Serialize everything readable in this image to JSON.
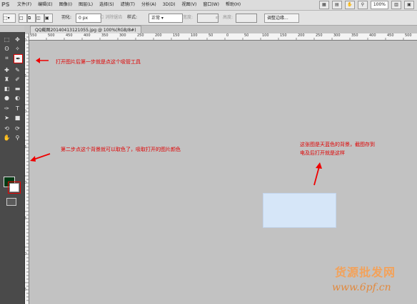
{
  "app": {
    "logo": "PS",
    "menu": [
      "文件(F)",
      "编辑(E)",
      "图像(I)",
      "图层(L)",
      "选择(S)",
      "滤镜(T)",
      "分析(A)",
      "3D(D)",
      "视图(V)",
      "窗口(W)",
      "帮助(H)"
    ],
    "zoom": "100%"
  },
  "options_bar": {
    "feather_label": "羽化:",
    "feather_value": "0 px",
    "antialias_label": "消除锯齿",
    "style_label": "样式:",
    "style_value": "正常",
    "width_label": "宽度:",
    "height_label": "高度:",
    "refine_edge_label": "调整边缘..."
  },
  "document": {
    "tab_title": "QQ截图20140413121055.jpg @ 100%(RGB/8#)",
    "ruler_ticks": [
      "550",
      "500",
      "450",
      "400",
      "350",
      "300",
      "250",
      "200",
      "150",
      "100",
      "50",
      "0",
      "50",
      "100",
      "150",
      "200",
      "250",
      "300",
      "350",
      "400",
      "450",
      "500",
      "550"
    ],
    "left_ruler_ticks": [
      "0",
      "5",
      "0",
      "5",
      "0",
      "5",
      "0",
      "5"
    ],
    "rect_color": "#d6e6f8"
  },
  "annotations": {
    "step1": "打开图片后第一步就是点这个吸管工具",
    "step2": "第二步点这个背景就可以取色了，吸取打开的图片颜色",
    "note_line1": "这张图是天蓝色的背景，截图存到",
    "note_line2": "电及后打开就是这样",
    "color": "#e00000"
  },
  "watermark": {
    "title": "货源批发网",
    "url": "www.6pf.cn"
  },
  "tools": [
    "marquee-icon",
    "move-icon",
    "lasso-icon",
    "magic-wand-icon",
    "crop-icon",
    "eyedropper-icon",
    "spot-heal-icon",
    "brush-icon",
    "stamp-icon",
    "history-brush-icon",
    "eraser-icon",
    "gradient-icon",
    "blur-icon",
    "dodge-icon",
    "pen-icon",
    "type-icon",
    "path-select-icon",
    "shape-icon",
    "3d-rotate-icon",
    "3d-camera-icon",
    "hand-icon",
    "zoom-icon"
  ],
  "colors": {
    "foreground": "#003a14",
    "background": "#ffffff"
  }
}
